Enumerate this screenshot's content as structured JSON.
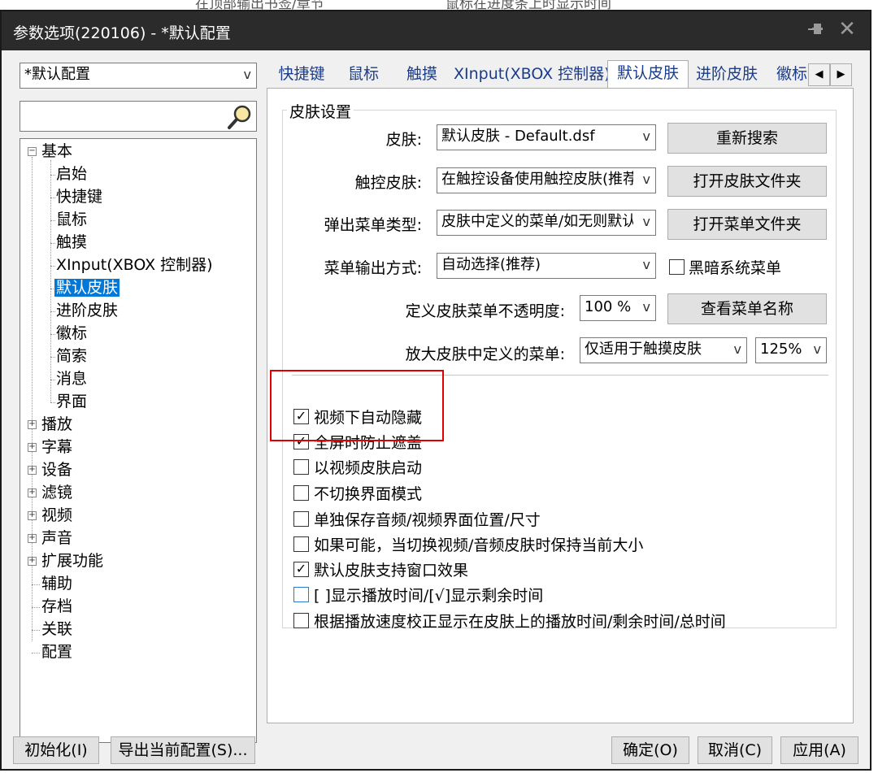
{
  "background_app": {
    "text_left": "在顶部输出书签/章节",
    "text_right": "鼠标在进度条上时显示时间"
  },
  "window": {
    "title": "参数选项(220106) - *默认配置",
    "pin_glyph": "📌",
    "close_glyph": "✕"
  },
  "profile": {
    "selected": "*默认配置",
    "arrow": "v"
  },
  "search": {
    "value": ""
  },
  "tree": {
    "items": [
      {
        "label": "基本",
        "expander": "−"
      },
      {
        "label": "启始"
      },
      {
        "label": "快捷键"
      },
      {
        "label": "鼠标"
      },
      {
        "label": "触摸"
      },
      {
        "label": "XInput(XBOX 控制器)"
      },
      {
        "label": "默认皮肤"
      },
      {
        "label": "进阶皮肤"
      },
      {
        "label": "徽标"
      },
      {
        "label": "简索"
      },
      {
        "label": "消息"
      },
      {
        "label": "界面"
      },
      {
        "label": "播放",
        "expander": "+"
      },
      {
        "label": "字幕",
        "expander": "+"
      },
      {
        "label": "设备",
        "expander": "+"
      },
      {
        "label": "滤镜",
        "expander": "+"
      },
      {
        "label": "视频",
        "expander": "+"
      },
      {
        "label": "声音",
        "expander": "+"
      },
      {
        "label": "扩展功能",
        "expander": "+"
      },
      {
        "label": "辅助"
      },
      {
        "label": "存档"
      },
      {
        "label": "关联"
      },
      {
        "label": "配置"
      }
    ]
  },
  "tabs": [
    {
      "label": "快捷键"
    },
    {
      "label": "鼠标"
    },
    {
      "label": "触摸"
    },
    {
      "label": "XInput(XBOX 控制器)"
    },
    {
      "label": "默认皮肤"
    },
    {
      "label": "进阶皮肤"
    },
    {
      "label": "徽标"
    }
  ],
  "tab_scroll": {
    "left": "◀",
    "right": "▶"
  },
  "skin": {
    "group_title": "皮肤设置",
    "skin_label": "皮肤:",
    "skin_value": "默认皮肤 - Default.dsf",
    "touch_label": "触控皮肤:",
    "touch_value": "在触控设备使用触控皮肤(推荐)",
    "popup_label": "弹出菜单类型:",
    "popup_value": "皮肤中定义的菜单/如无则默认",
    "output_label": "菜单输出方式:",
    "output_value": "自动选择(推荐)",
    "dark_menu_label": "黑暗系统菜单",
    "opacity_label": "定义皮肤菜单不透明度:",
    "opacity_value": "100 %",
    "zoom_label": "放大皮肤中定义的菜单:",
    "zoom_mode_value": "仅适用于触摸皮肤",
    "zoom_pct_value": "125%",
    "arrow": "v",
    "btn_research": "重新搜索",
    "btn_open_skin_folder": "打开皮肤文件夹",
    "btn_open_menu_folder": "打开菜单文件夹",
    "btn_view_menu_names": "查看菜单名称"
  },
  "checkboxes": [
    {
      "label": "视频下自动隐藏",
      "mark": "✓"
    },
    {
      "label": "全屏时防止遮盖",
      "mark": "✓"
    },
    {
      "label": "以视频皮肤启动",
      "mark": ""
    },
    {
      "label": "不切换界面模式",
      "mark": ""
    },
    {
      "label": "单独保存音频/视频界面位置/尺寸",
      "mark": ""
    },
    {
      "label": "如果可能，当切换视频/音频皮肤时保持当前大小",
      "mark": ""
    },
    {
      "label": "默认皮肤支持窗口效果",
      "mark": "✓"
    },
    {
      "label": "[ ]显示播放时间/[√]显示剩余时间",
      "mark": ""
    },
    {
      "label": "根据播放速度校正显示在皮肤上的播放时间/剩余时间/总时间",
      "mark": ""
    }
  ],
  "footer": {
    "init": "初始化(I)",
    "export": "导出当前配置(S)...",
    "ok": "确定(O)",
    "cancel": "取消(C)",
    "apply": "应用(A)"
  },
  "colors": {
    "selection": "#0078d7",
    "highlight_box": "#e00000",
    "titlebar": "#2b2b2b"
  }
}
